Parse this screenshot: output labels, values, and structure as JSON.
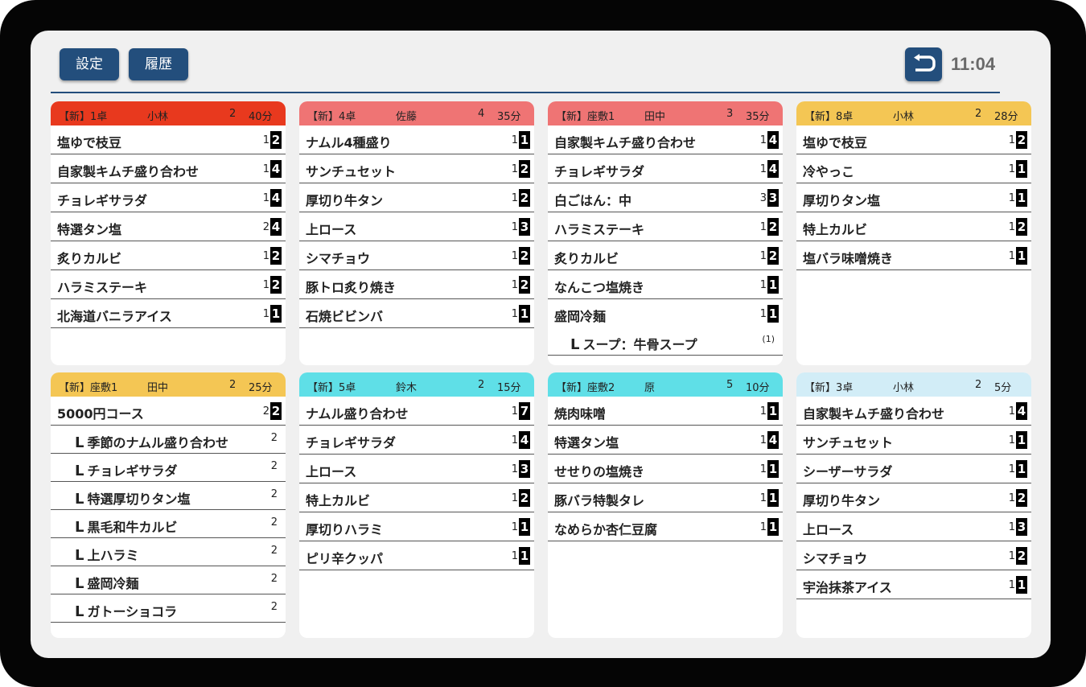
{
  "header": {
    "settings_label": "設定",
    "history_label": "履歴",
    "time": "11:04"
  },
  "colors": {
    "red": "#e8391e",
    "pink": "#ef7474",
    "yellow": "#f4c654",
    "cyan": "#5fdfe7",
    "lightblue": "#d2edf7",
    "navy": "#234e7c"
  },
  "orders": [
    {
      "title": "【新】1卓",
      "staff": "小林",
      "guests": "2",
      "elapsed": "40分",
      "color": "red",
      "items": [
        {
          "name": "塩ゆで枝豆",
          "qty": "1",
          "total": "2"
        },
        {
          "name": "自家製キムチ盛り合わせ",
          "qty": "1",
          "total": "4"
        },
        {
          "name": "チョレギサラダ",
          "qty": "1",
          "total": "4"
        },
        {
          "name": "特選タン塩",
          "qty": "2",
          "total": "4"
        },
        {
          "name": "炙りカルビ",
          "qty": "1",
          "total": "2"
        },
        {
          "name": "ハラミステーキ",
          "qty": "1",
          "total": "2"
        },
        {
          "name": "北海道バニラアイス",
          "qty": "1",
          "total": "1"
        }
      ]
    },
    {
      "title": "【新】4卓",
      "staff": "佐藤",
      "guests": "4",
      "elapsed": "35分",
      "color": "pink",
      "items": [
        {
          "name": "ナムル4種盛り",
          "qty": "1",
          "total": "1"
        },
        {
          "name": "サンチュセット",
          "qty": "1",
          "total": "2"
        },
        {
          "name": "厚切り牛タン",
          "qty": "1",
          "total": "2"
        },
        {
          "name": "上ロース",
          "qty": "1",
          "total": "3"
        },
        {
          "name": "シマチョウ",
          "qty": "1",
          "total": "2"
        },
        {
          "name": "豚トロ炙り焼き",
          "qty": "1",
          "total": "2"
        },
        {
          "name": "石焼ビビンバ",
          "qty": "1",
          "total": "1"
        }
      ]
    },
    {
      "title": "【新】座敷1",
      "staff": "田中",
      "guests": "3",
      "elapsed": "35分",
      "color": "pink",
      "items": [
        {
          "name": "自家製キムチ盛り合わせ",
          "qty": "1",
          "total": "4"
        },
        {
          "name": "チョレギサラダ",
          "qty": "1",
          "total": "4"
        },
        {
          "name": "白ごはん：中",
          "qty": "3",
          "total": "3"
        },
        {
          "name": "ハラミステーキ",
          "qty": "1",
          "total": "2"
        },
        {
          "name": "炙りカルビ",
          "qty": "1",
          "total": "2"
        },
        {
          "name": "なんこつ塩焼き",
          "qty": "1",
          "total": "1"
        },
        {
          "name": "盛岡冷麺",
          "qty": "1",
          "total": "1"
        }
      ],
      "sub": {
        "name": "スープ：牛骨スープ",
        "qty": "(1)"
      }
    },
    {
      "title": "【新】8卓",
      "staff": "小林",
      "guests": "2",
      "elapsed": "28分",
      "color": "yellow",
      "items": [
        {
          "name": "塩ゆで枝豆",
          "qty": "1",
          "total": "2"
        },
        {
          "name": "冷やっこ",
          "qty": "1",
          "total": "1"
        },
        {
          "name": "厚切りタン塩",
          "qty": "1",
          "total": "1"
        },
        {
          "name": "特上カルビ",
          "qty": "1",
          "total": "2"
        },
        {
          "name": "塩バラ味噌焼き",
          "qty": "1",
          "total": "1"
        }
      ]
    },
    {
      "title": "【新】座敷1",
      "staff": "田中",
      "guests": "2",
      "elapsed": "25分",
      "color": "yellow",
      "course": {
        "name": "5000円コース",
        "qty": "2",
        "total": "2"
      },
      "subs": [
        {
          "name": "季節のナムル盛り合わせ",
          "qty": "2"
        },
        {
          "name": "チョレギサラダ",
          "qty": "2"
        },
        {
          "name": "特選厚切りタン塩",
          "qty": "2"
        },
        {
          "name": "黒毛和牛カルビ",
          "qty": "2"
        },
        {
          "name": "上ハラミ",
          "qty": "2"
        },
        {
          "name": "盛岡冷麺",
          "qty": "2"
        },
        {
          "name": "ガトーショコラ",
          "qty": "2"
        }
      ]
    },
    {
      "title": "【新】5卓",
      "staff": "鈴木",
      "guests": "2",
      "elapsed": "15分",
      "color": "cyan",
      "items": [
        {
          "name": "ナムル盛り合わせ",
          "qty": "1",
          "total": "7"
        },
        {
          "name": "チョレギサラダ",
          "qty": "1",
          "total": "4"
        },
        {
          "name": "上ロース",
          "qty": "1",
          "total": "3"
        },
        {
          "name": "特上カルビ",
          "qty": "1",
          "total": "2"
        },
        {
          "name": "厚切りハラミ",
          "qty": "1",
          "total": "1"
        },
        {
          "name": "ピリ辛クッパ",
          "qty": "1",
          "total": "1"
        }
      ]
    },
    {
      "title": "【新】座敷2",
      "staff": "原",
      "guests": "5",
      "elapsed": "10分",
      "color": "cyan",
      "items": [
        {
          "name": "焼肉味噌",
          "qty": "1",
          "total": "1"
        },
        {
          "name": "特選タン塩",
          "qty": "1",
          "total": "4"
        },
        {
          "name": "せせりの塩焼き",
          "qty": "1",
          "total": "1"
        },
        {
          "name": "豚バラ特製タレ",
          "qty": "1",
          "total": "1"
        },
        {
          "name": "なめらか杏仁豆腐",
          "qty": "1",
          "total": "1"
        }
      ]
    },
    {
      "title": "【新】3卓",
      "staff": "小林",
      "guests": "2",
      "elapsed": "5分",
      "color": "lightblue",
      "items": [
        {
          "name": "自家製キムチ盛り合わせ",
          "qty": "1",
          "total": "4"
        },
        {
          "name": "サンチュセット",
          "qty": "1",
          "total": "1"
        },
        {
          "name": "シーザーサラダ",
          "qty": "1",
          "total": "1"
        },
        {
          "name": "厚切り牛タン",
          "qty": "1",
          "total": "2"
        },
        {
          "name": "上ロース",
          "qty": "1",
          "total": "3"
        },
        {
          "name": "シマチョウ",
          "qty": "1",
          "total": "2"
        },
        {
          "name": "宇治抹茶アイス",
          "qty": "1",
          "total": "1"
        }
      ]
    }
  ]
}
